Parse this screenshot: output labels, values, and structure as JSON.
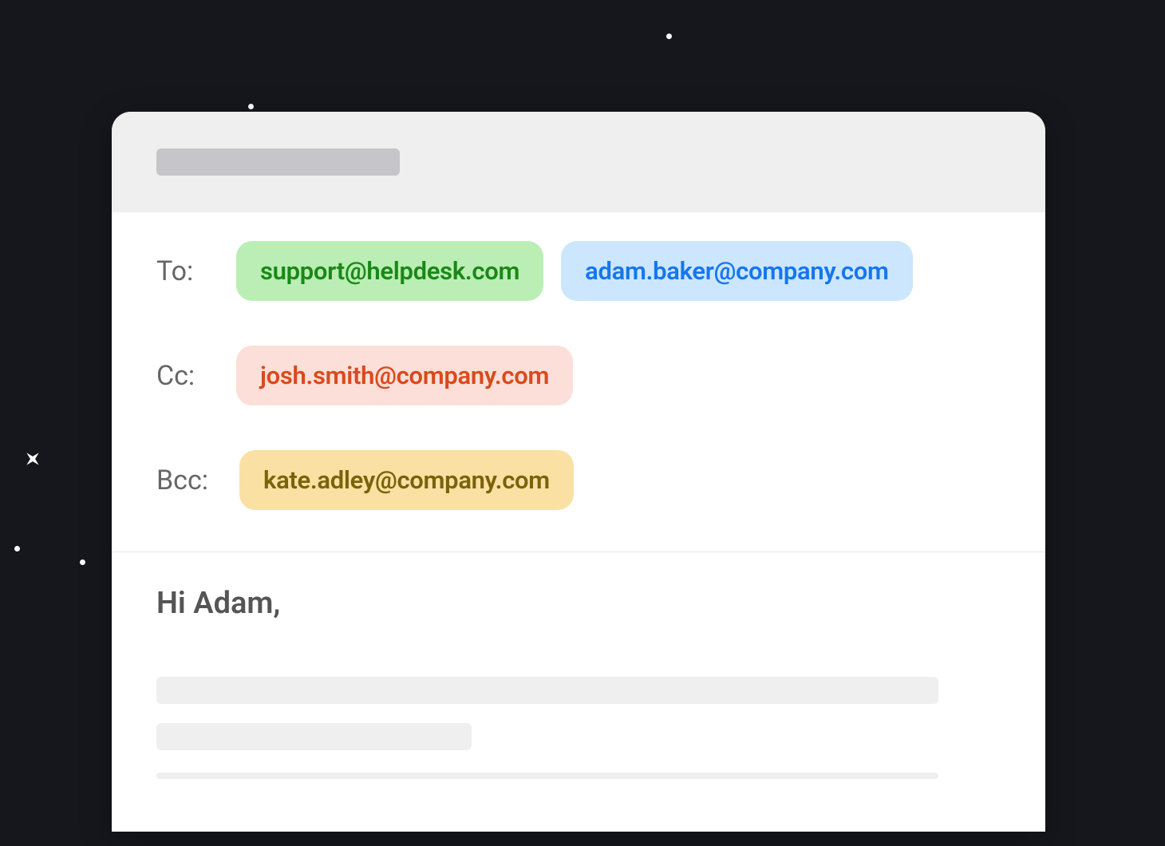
{
  "compose": {
    "fields": {
      "to_label": "To:",
      "cc_label": "Cc:",
      "bcc_label": "Bcc:"
    },
    "recipients": {
      "to": [
        {
          "email": "support@helpdesk.com",
          "color": "green"
        },
        {
          "email": "adam.baker@company.com",
          "color": "blue"
        }
      ],
      "cc": [
        {
          "email": "josh.smith@company.com",
          "color": "red"
        }
      ],
      "bcc": [
        {
          "email": "kate.adley@company.com",
          "color": "yellow"
        }
      ]
    },
    "body": {
      "greeting": "Hi Adam,"
    }
  },
  "colors": {
    "background": "#15171c",
    "chip_green_bg": "#baeeb4",
    "chip_green_text": "#1a8817",
    "chip_blue_bg": "#cbe6fd",
    "chip_blue_text": "#1676ed",
    "chip_red_bg": "#fcdfd8",
    "chip_red_text": "#d94a1c",
    "chip_yellow_bg": "#fbe0a4",
    "chip_yellow_text": "#7a6209"
  }
}
